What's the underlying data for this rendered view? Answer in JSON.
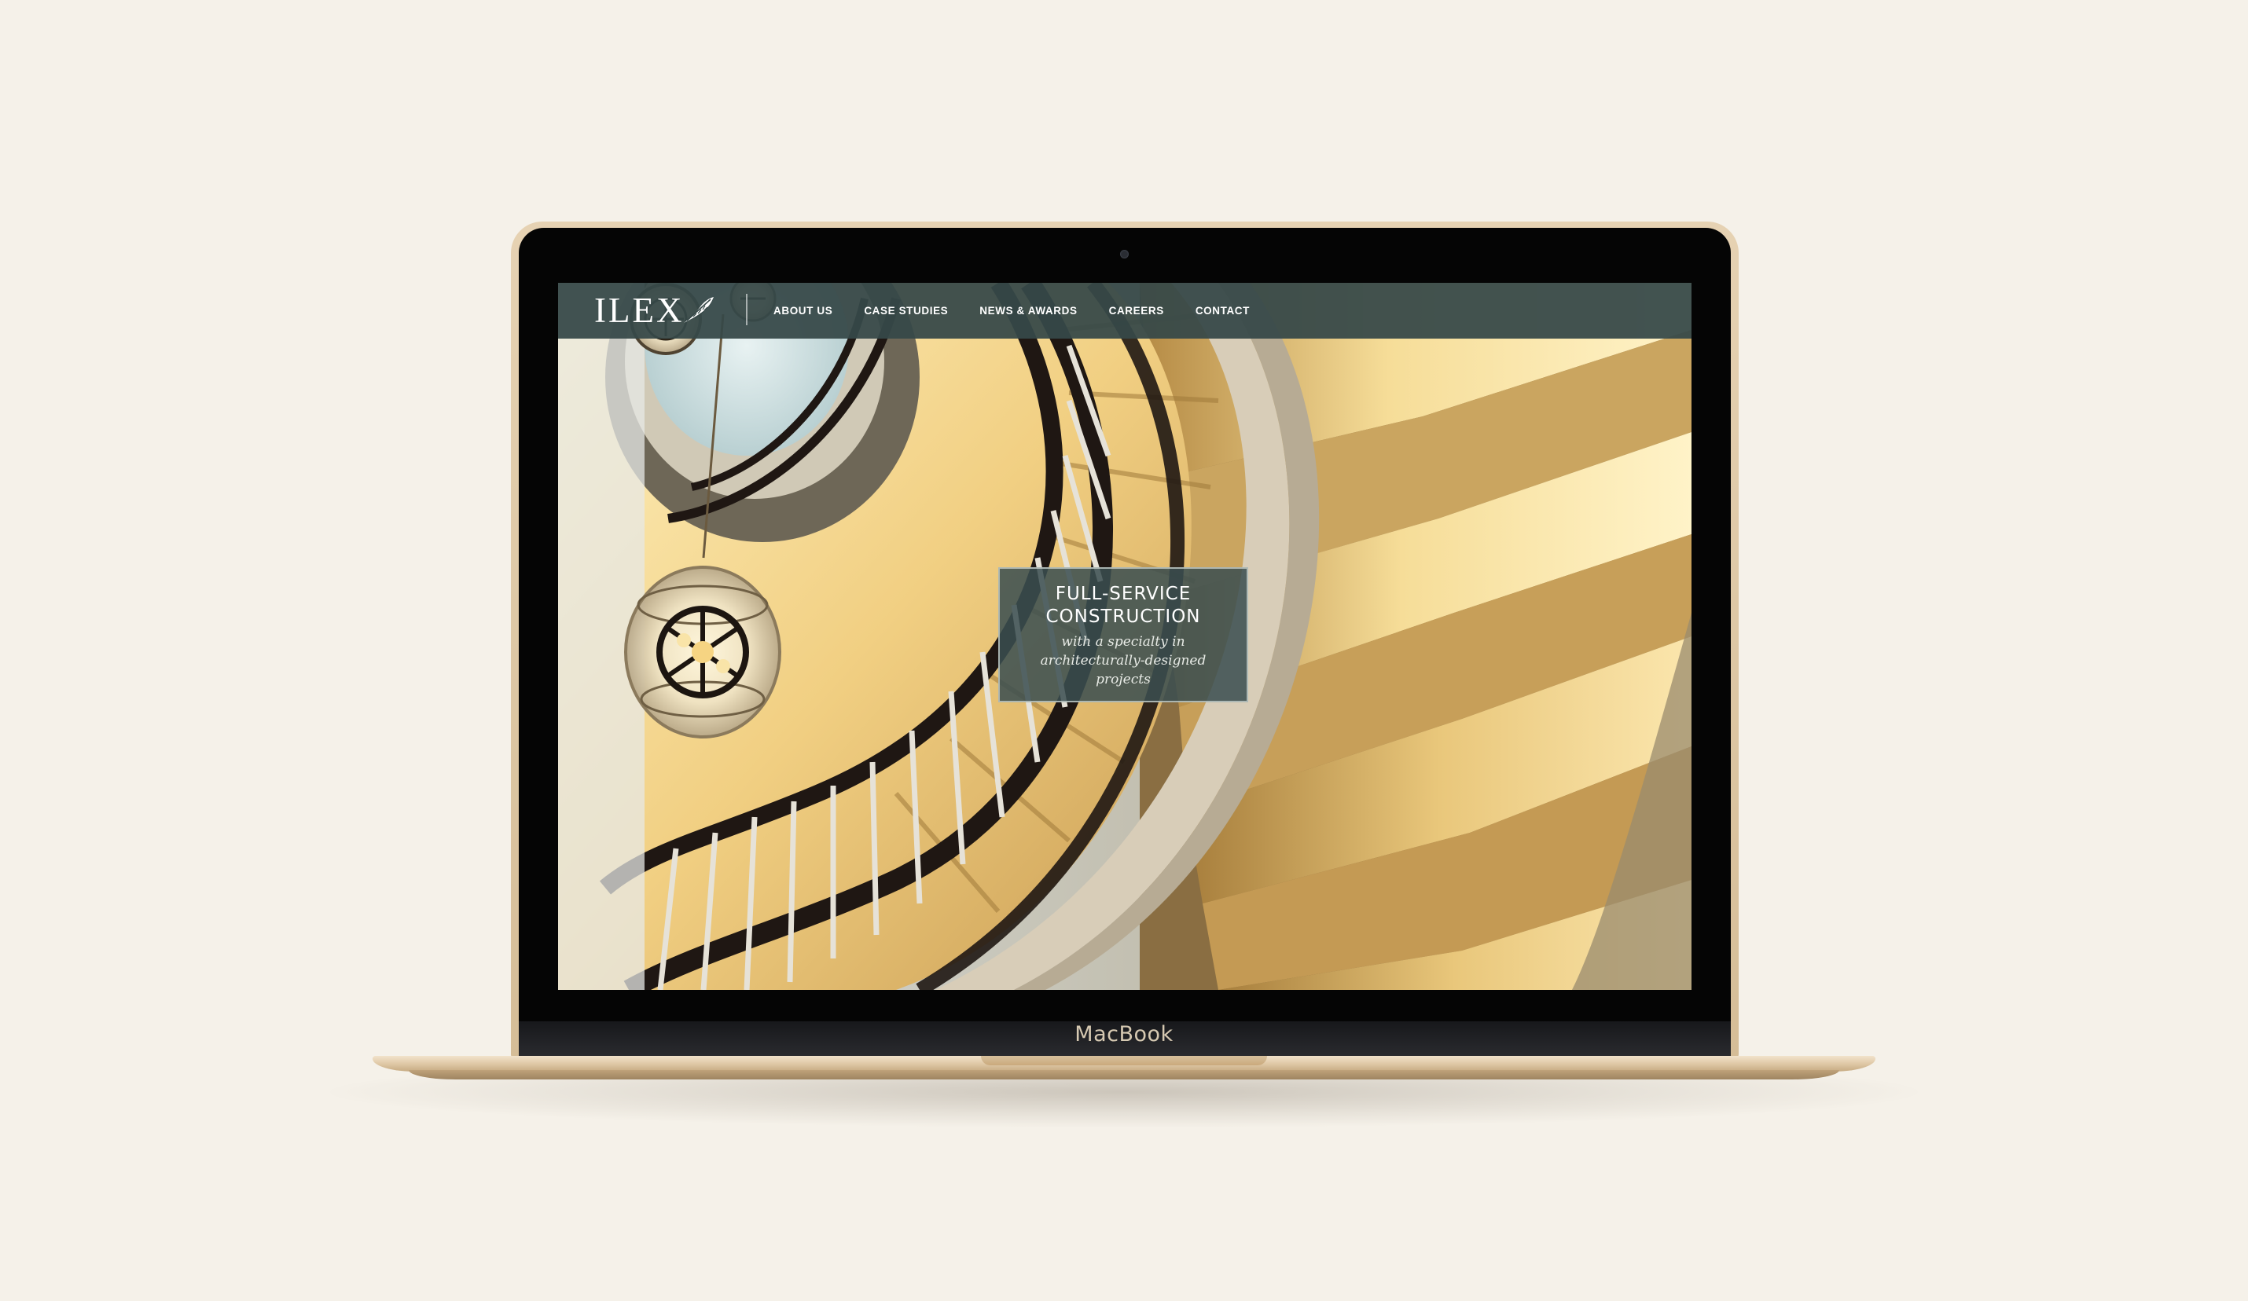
{
  "device": {
    "label": "MacBook"
  },
  "site": {
    "logo_text": "ILEX",
    "logo_icon": "leaf-icon",
    "nav_items": [
      {
        "label": "ABOUT US"
      },
      {
        "label": "CASE STUDIES"
      },
      {
        "label": "NEWS & AWARDS"
      },
      {
        "label": "CAREERS"
      },
      {
        "label": "CONTACT"
      }
    ],
    "hero": {
      "title_line1": "FULL-SERVICE",
      "title_line2": "CONSTRUCTION",
      "subtitle": "with a specialty in architecturally-designed projects"
    }
  },
  "colors": {
    "navbar": "#364848",
    "hero_box": "#3a4e50",
    "page_background": "#f5f1e9",
    "laptop_gold": "#d5bd97"
  }
}
